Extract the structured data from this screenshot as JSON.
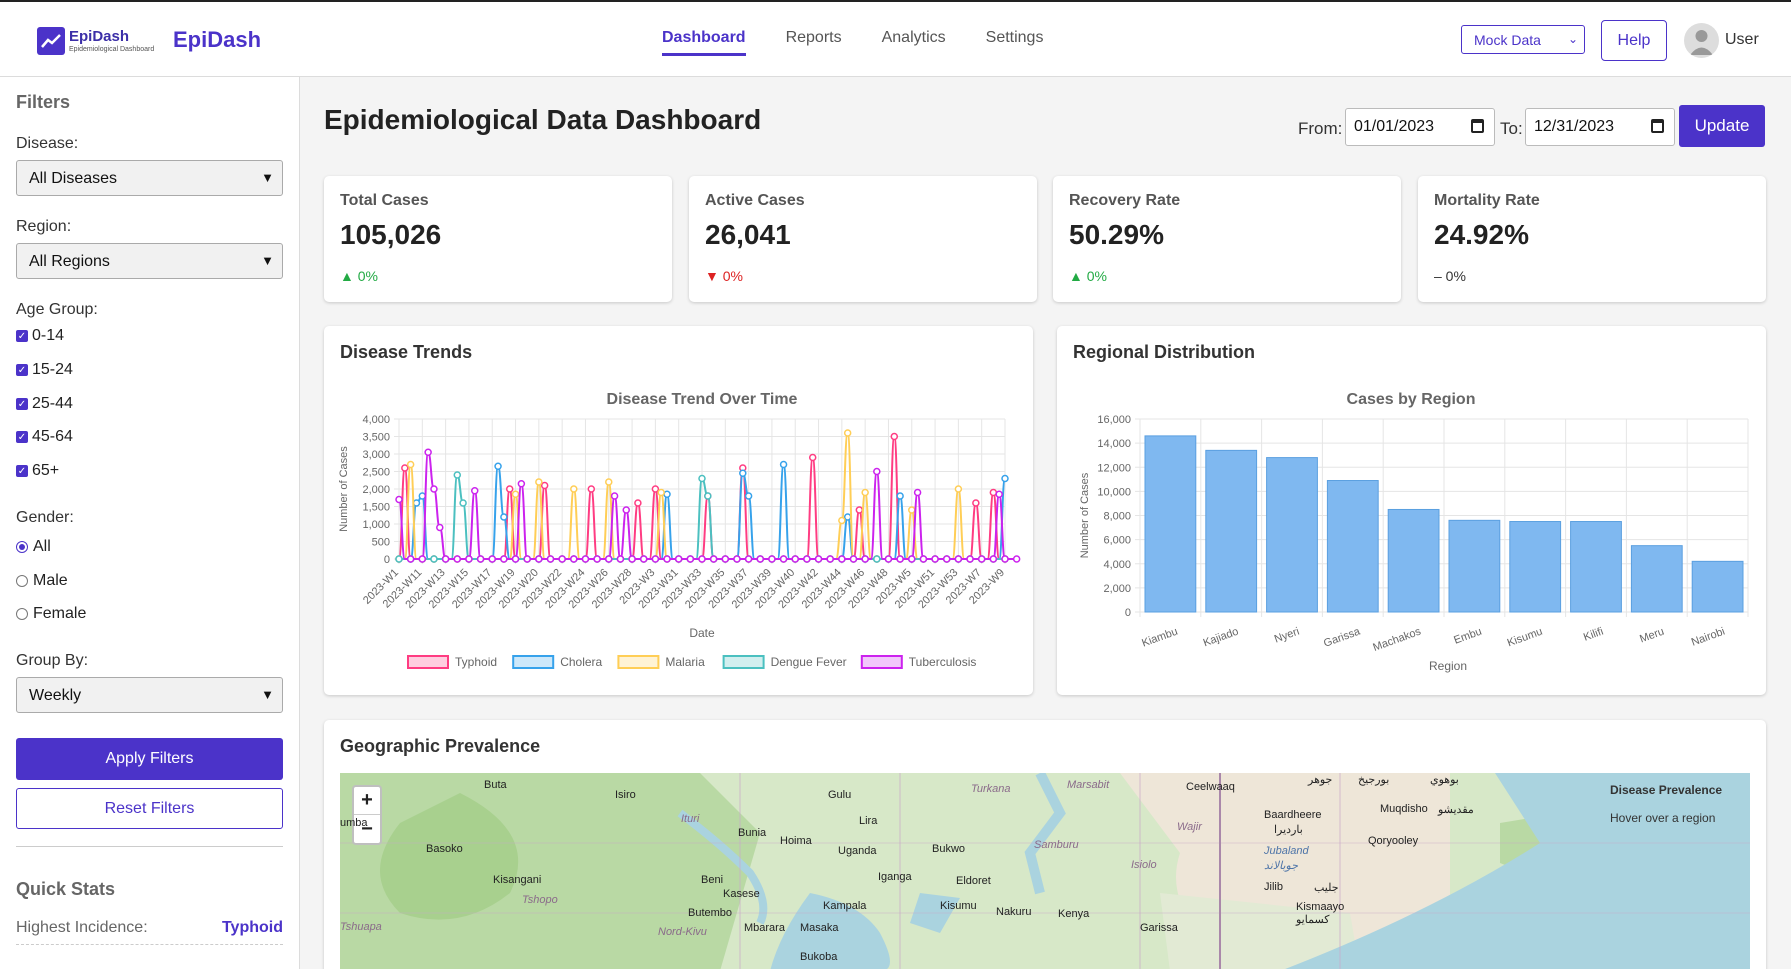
{
  "header": {
    "logo_name": "EpiDash",
    "logo_subtitle": "Epidemiological Dashboard",
    "brand": "EpiDash",
    "nav": [
      "Dashboard",
      "Reports",
      "Analytics",
      "Settings"
    ],
    "active_nav": "Dashboard",
    "data_source": "Mock Data",
    "help": "Help",
    "user": "User"
  },
  "sidebar": {
    "title": "Filters",
    "disease_label": "Disease:",
    "disease_value": "All Diseases",
    "region_label": "Region:",
    "region_value": "All Regions",
    "age_label": "Age Group:",
    "age_groups": [
      "0-14",
      "15-24",
      "25-44",
      "45-64",
      "65+"
    ],
    "gender_label": "Gender:",
    "genders": [
      "All",
      "Male",
      "Female"
    ],
    "gender_selected": "All",
    "group_by_label": "Group By:",
    "group_by_value": "Weekly",
    "apply": "Apply Filters",
    "reset": "Reset Filters",
    "quick_stats_title": "Quick Stats",
    "highest_incidence_label": "Highest Incidence:",
    "highest_incidence_value": "Typhoid"
  },
  "main": {
    "title": "Epidemiological Data Dashboard",
    "from_label": "From:",
    "from_value": "01/01/2023",
    "to_label": "To:",
    "to_value": "12/31/2023",
    "update": "Update"
  },
  "stats": [
    {
      "title": "Total Cases",
      "value": "105,026",
      "change": "▲ 0%",
      "color": "#22aa44"
    },
    {
      "title": "Active Cases",
      "value": "26,041",
      "change": "▼ 0%",
      "color": "#dd2222"
    },
    {
      "title": "Recovery Rate",
      "value": "50.29%",
      "change": "▲ 0%",
      "color": "#22aa44"
    },
    {
      "title": "Mortality Rate",
      "value": "24.92%",
      "change": "– 0%",
      "color": "#333333"
    }
  ],
  "panels": {
    "trends": "Disease Trends",
    "regional": "Regional Distribution",
    "geo": "Geographic Prevalence"
  },
  "map": {
    "legend_title": "Disease Prevalence",
    "legend_hint": "Hover over a region",
    "zoom_in": "+",
    "zoom_out": "−",
    "labels": [
      "Buta",
      "Isiro",
      "Gulu",
      "Turkana",
      "Marsabit",
      "Ceelwaaq",
      "جوهر",
      "بورجيخ",
      "بوهوي",
      "Baardheere",
      "بارديرا",
      "Muqdisho",
      "مقديشو",
      "Bunia",
      "Lira",
      "Hoima",
      "Uganda",
      "Bukwo",
      "Samburu",
      "Wajir",
      "Qoryooley",
      "Jubaland",
      "جوبالاند",
      "Basoko",
      "Kisangani",
      "Ituri",
      "Beni",
      "Iganga",
      "Eldoret",
      "Isiolo",
      "Jilib",
      "جليب",
      "Tshopo",
      "Kasese",
      "Kampala",
      "Kisumu",
      "Nakuru",
      "Kenya",
      "Kismaayo",
      "كسمايو",
      "Butembo",
      "Mbarara",
      "Masaka",
      "Garissa",
      "Tshuapa",
      "Nord-Kivu",
      "Bukoba",
      "umba"
    ]
  },
  "chart_data": [
    {
      "type": "line",
      "title": "Disease Trend Over Time",
      "xlabel": "Date",
      "ylabel": "Number of Cases",
      "ylim": [
        0,
        4000
      ],
      "yticks": [
        "0",
        "500",
        "1,000",
        "1,500",
        "2,000",
        "2,500",
        "3,000",
        "3,500",
        "4,000"
      ],
      "tick_labels": [
        "2023-W1",
        "2023-W11",
        "2023-W13",
        "2023-W15",
        "2023-W17",
        "2023-W19",
        "2023-W20",
        "2023-W22",
        "2023-W24",
        "2023-W26",
        "2023-W28",
        "2023-W3",
        "2023-W31",
        "2023-W33",
        "2023-W35",
        "2023-W37",
        "2023-W39",
        "2023-W40",
        "2023-W42",
        "2023-W44",
        "2023-W46",
        "2023-W48",
        "2023-W5",
        "2023-W51",
        "2023-W53",
        "2023-W7",
        "2023-W9"
      ],
      "legend_position": "bottom",
      "grid": true,
      "series": [
        {
          "name": "Typhoid",
          "color": "#ff3c82",
          "values": [
            0,
            2600,
            0,
            0,
            0,
            0,
            0,
            0,
            0,
            0,
            0,
            0,
            0,
            0,
            0,
            0,
            0,
            0,
            0,
            2000,
            0,
            0,
            0,
            0,
            0,
            2100,
            0,
            0,
            0,
            0,
            0,
            0,
            0,
            2000,
            0,
            0,
            0,
            0,
            0,
            0,
            0,
            1600,
            0,
            0,
            2000,
            0,
            0,
            0,
            0,
            0,
            0,
            0,
            0,
            1800,
            0,
            0,
            0,
            0,
            0,
            2600,
            0,
            0,
            0,
            0,
            0,
            0,
            0,
            0,
            0,
            0,
            0,
            2900,
            0,
            0,
            0,
            0,
            0,
            0,
            0,
            1400,
            0,
            0,
            0,
            0,
            0,
            3500,
            0,
            0,
            0,
            0,
            0,
            0,
            0,
            0,
            0,
            0,
            0,
            0,
            0,
            1600,
            0,
            0,
            1900,
            0,
            0
          ]
        },
        {
          "name": "Cholera",
          "color": "#36a2eb",
          "values": [
            0,
            0,
            0,
            1600,
            1800,
            0,
            0,
            0,
            0,
            0,
            0,
            0,
            0,
            0,
            0,
            0,
            0,
            2650,
            1200,
            0,
            0,
            0,
            0,
            0,
            0,
            0,
            0,
            0,
            0,
            0,
            0,
            0,
            0,
            0,
            0,
            0,
            0,
            0,
            0,
            0,
            0,
            0,
            0,
            0,
            0,
            0,
            1850,
            0,
            0,
            0,
            0,
            0,
            0,
            0,
            0,
            0,
            0,
            0,
            0,
            2450,
            1800,
            0,
            0,
            0,
            0,
            0,
            2700,
            0,
            0,
            0,
            0,
            0,
            0,
            0,
            0,
            0,
            0,
            1200,
            0,
            0,
            0,
            0,
            0,
            0,
            0,
            0,
            1800,
            0,
            0,
            0,
            0,
            0,
            0,
            0,
            0,
            0,
            0,
            0,
            0,
            0,
            0,
            0,
            0,
            0,
            2300
          ]
        },
        {
          "name": "Malaria",
          "color": "#ffce56",
          "values": [
            0,
            0,
            2700,
            0,
            0,
            0,
            0,
            0,
            0,
            0,
            0,
            0,
            0,
            0,
            0,
            0,
            0,
            0,
            0,
            0,
            1850,
            0,
            0,
            0,
            2200,
            0,
            0,
            0,
            0,
            0,
            2000,
            0,
            0,
            0,
            0,
            0,
            2200,
            0,
            0,
            0,
            0,
            0,
            0,
            0,
            0,
            1900,
            0,
            0,
            0,
            0,
            0,
            0,
            0,
            0,
            0,
            0,
            0,
            0,
            0,
            0,
            0,
            0,
            0,
            0,
            0,
            0,
            0,
            0,
            0,
            0,
            0,
            0,
            0,
            0,
            0,
            0,
            1100,
            3600,
            0,
            0,
            1900,
            0,
            0,
            0,
            0,
            0,
            0,
            0,
            1400,
            0,
            0,
            0,
            0,
            0,
            0,
            0,
            2000,
            0,
            0,
            0,
            0,
            0,
            0,
            0,
            0
          ]
        },
        {
          "name": "Dengue Fever",
          "color": "#4bc0c0",
          "values": [
            0,
            0,
            0,
            0,
            0,
            0,
            0,
            0,
            0,
            0,
            2400,
            1600,
            0,
            0,
            0,
            0,
            0,
            0,
            0,
            0,
            0,
            0,
            0,
            0,
            0,
            0,
            0,
            0,
            0,
            0,
            0,
            0,
            0,
            0,
            0,
            0,
            0,
            0,
            0,
            0,
            0,
            0,
            0,
            0,
            0,
            0,
            0,
            0,
            0,
            0,
            0,
            0,
            2300,
            1800,
            0,
            0,
            0,
            0,
            0,
            0,
            0,
            0,
            0,
            0,
            0,
            0,
            0,
            0,
            0,
            0,
            0,
            0,
            0,
            0,
            0,
            0,
            0,
            0,
            0,
            0,
            0,
            0,
            0,
            0,
            0,
            0,
            0,
            0,
            0,
            0,
            0,
            0,
            0,
            0,
            0,
            0,
            0,
            0,
            0,
            0,
            0,
            0,
            0,
            0,
            0
          ]
        },
        {
          "name": "Tuberculosis",
          "color": "#cc22ee",
          "values": [
            1700,
            0,
            0,
            0,
            0,
            3050,
            2000,
            900,
            0,
            0,
            0,
            0,
            0,
            1950,
            0,
            0,
            0,
            0,
            0,
            0,
            0,
            2150,
            0,
            0,
            0,
            0,
            0,
            0,
            0,
            0,
            0,
            0,
            0,
            0,
            0,
            0,
            0,
            1800,
            0,
            1400,
            0,
            0,
            0,
            0,
            0,
            0,
            0,
            0,
            0,
            0,
            0,
            0,
            0,
            0,
            0,
            0,
            0,
            0,
            0,
            0,
            0,
            0,
            0,
            0,
            0,
            0,
            0,
            0,
            0,
            0,
            0,
            0,
            0,
            0,
            0,
            0,
            0,
            0,
            0,
            0,
            0,
            0,
            2500,
            0,
            0,
            0,
            0,
            0,
            0,
            1900,
            0,
            0,
            0,
            0,
            0,
            0,
            0,
            0,
            0,
            0,
            0,
            0,
            0,
            1850,
            0,
            0,
            0
          ]
        }
      ]
    },
    {
      "type": "bar",
      "title": "Cases by Region",
      "xlabel": "Region",
      "ylabel": "Number of Cases",
      "ylim": [
        0,
        16000
      ],
      "yticks": [
        "0",
        "2,000",
        "4,000",
        "6,000",
        "8,000",
        "10,000",
        "12,000",
        "14,000",
        "16,000"
      ],
      "categories": [
        "Kiambu",
        "Kajiado",
        "Nyeri",
        "Garissa",
        "Machakos",
        "Embu",
        "Kisumu",
        "Kilifi",
        "Meru",
        "Nairobi"
      ],
      "values": [
        14600,
        13400,
        12800,
        10900,
        8500,
        7600,
        7500,
        7500,
        5500,
        4200
      ],
      "color": "#7fb8f0",
      "grid": true
    }
  ]
}
